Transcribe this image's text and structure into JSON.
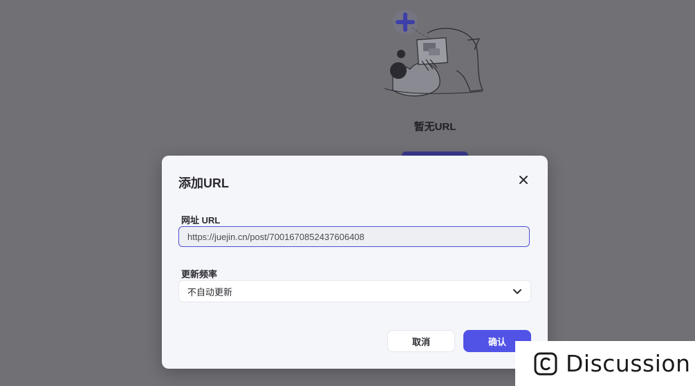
{
  "empty_state": {
    "title": "暂无URL",
    "illustration_icon": "person-reading-illustration",
    "add_icon": "plus-icon"
  },
  "modal": {
    "title": "添加URL",
    "close_icon": "close-icon",
    "url_field": {
      "label": "网址 URL",
      "value": "https://juejin.cn/post/7001670852437606408"
    },
    "frequency_field": {
      "label": "更新频率",
      "selected": "不自动更新",
      "chevron_icon": "chevron-down-icon"
    },
    "cancel_label": "取消",
    "confirm_label": "确认"
  },
  "discussion": {
    "label": "Discussion",
    "icon": "copyright-c-icon"
  },
  "colors": {
    "overlay": "#707075",
    "primary": "#5152e6",
    "modal_bg": "#f5f6fa"
  }
}
